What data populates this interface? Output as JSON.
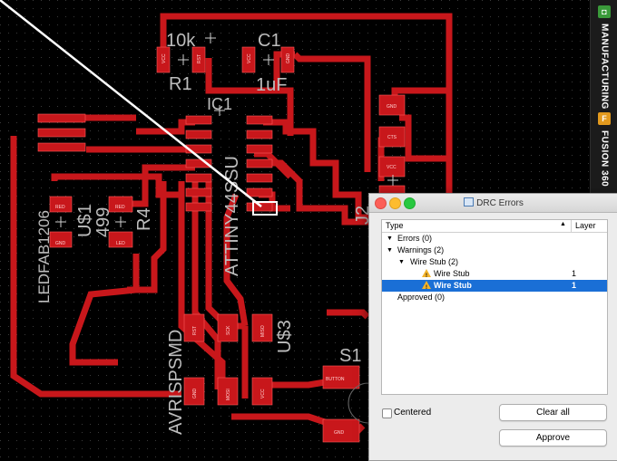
{
  "board": {
    "labels": {
      "r1_value": "10k",
      "r1_name": "R1",
      "c1_name": "C1",
      "c1_value": "1uF",
      "ic1_name": "IC1",
      "ic1_part": "ATTINY44SSU",
      "j2_name": "J2",
      "u1_value": "499",
      "u1_name": "U$1",
      "r4_name": "R4",
      "led_part": "LEDFAB1206",
      "u3_name": "U$3",
      "avr_part": "AVRISPSMD",
      "s1_name": "S1"
    },
    "pads": {
      "r1_vcc": "VCC",
      "r1_rst": "RST",
      "c1_vcc": "VCC",
      "c1_gnd": "GND",
      "j2_gnd": "GND",
      "j2_cts": "CTS",
      "j2_vcc": "VCC",
      "led_red": "RED",
      "led_gnd": "GND",
      "r4_red": "RED",
      "r4_led": "LED",
      "avr_rst": "RST",
      "avr_sck": "SCK",
      "avr_miso": "MISO",
      "avr_gnd": "GND",
      "avr_mosi": "MOSI",
      "avr_vcc": "VCC",
      "s1_button": "BUTTON",
      "s1_gnd": "GND"
    }
  },
  "sidebar": {
    "manufacturing": {
      "badge": "◘",
      "label": "MANUFACTURING",
      "color": "#3a9a3a"
    },
    "fusion360": {
      "badge": "F",
      "label": "FUSION 360",
      "color": "#e39a1e"
    }
  },
  "drc": {
    "title": "DRC Errors",
    "columns": {
      "type": "Type",
      "sort_arrow": "▲",
      "layer": "Layer"
    },
    "tree": {
      "errors": "Errors (0)",
      "warnings": "Warnings (2)",
      "wire_stub_group": "Wire Stub (2)",
      "items": [
        {
          "label": "Wire Stub",
          "layer": "1",
          "selected": false
        },
        {
          "label": "Wire Stub",
          "layer": "1",
          "selected": true
        }
      ],
      "approved": "Approved (0)"
    },
    "centered_label": "Centered",
    "clear_all_label": "Clear all",
    "approve_label": "Approve"
  },
  "colors": {
    "copper": "#c8171b",
    "background": "#000000",
    "selection": "#1a6fd6",
    "warning": "#f3b42c"
  }
}
